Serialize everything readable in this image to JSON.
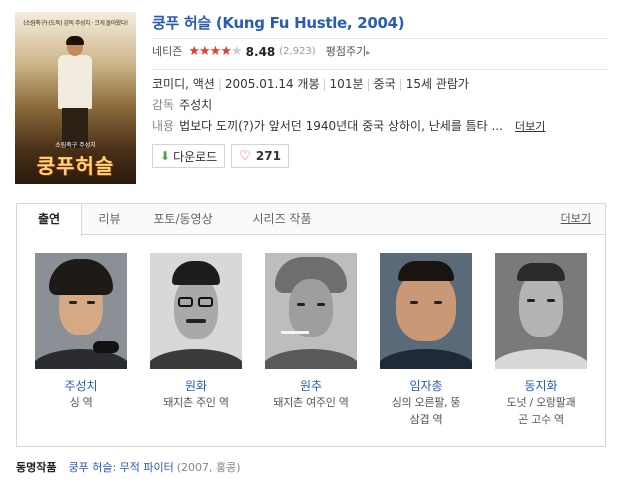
{
  "movie": {
    "title": "쿵푸 허슬 (Kung Fu Hustle, 2004)",
    "rating_label": "네티즌",
    "stars_on": "★★★★",
    "stars_off": "★",
    "score": "8.48",
    "rating_count": "(2,923)",
    "rate_link": "평점주기",
    "genre": "코미디, 액션",
    "release": "2005.01.14 개봉",
    "runtime": "101분",
    "country": "중국",
    "age": "15세 관람가",
    "director_label": "감독",
    "director": "주성치",
    "plot_label": "내용",
    "plot": "법보다 도끼(?)가 앞서던 1940년대 중국 상하이, 난세를 틈타 ...",
    "plot_more": "더보기",
    "download_label": "다운로드",
    "like_count": "271",
    "poster": {
      "tagline": "(소림축구)·(도둑) 감독 주성치 · 크게 돌아왔다!",
      "credit": "소림축구 주성치",
      "title": "쿵푸허슬"
    }
  },
  "tabs": [
    {
      "label": "출연"
    },
    {
      "label": "리뷰"
    },
    {
      "label": "포토/동영상"
    },
    {
      "label": "시리즈 작품"
    }
  ],
  "tabs_more": "더보기",
  "cast": [
    {
      "name": "주성치",
      "role": "싱 역",
      "role2": ""
    },
    {
      "name": "원화",
      "role": "돼지촌 주인 역",
      "role2": ""
    },
    {
      "name": "원추",
      "role": "돼지촌 여주인 역",
      "role2": ""
    },
    {
      "name": "임자총",
      "role": "싱의 오른팔, 뚱",
      "role2": "삼겹 역"
    },
    {
      "name": "동지화",
      "role": "도넛 / 오랑팔괘",
      "role2": "곤 고수 역"
    }
  ],
  "footer": {
    "label": "동명작품",
    "link": "쿵푸 허슬: 무적 파이터",
    "meta": "(2007, 홍콩)"
  },
  "colors": {
    "title_blue": "#2a5bb8",
    "star_red": "#ea3b2f",
    "download_green": "#4aa348",
    "heart_red": "#e94a44"
  },
  "icons": [
    "download-icon",
    "heart-icon",
    "chevron-right-icon"
  ]
}
